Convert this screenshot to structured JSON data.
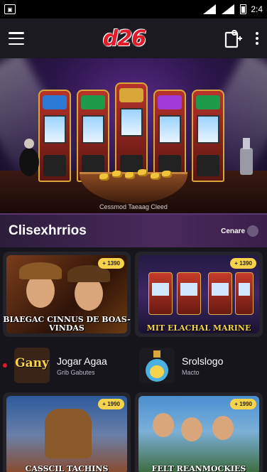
{
  "status_bar": {
    "time": "2:4"
  },
  "header": {
    "logo": "d26",
    "colors": {
      "logo": "#e21b2b",
      "accent": "#f6d34a"
    }
  },
  "banner": {
    "caption": "Cessmod Taeaag Cleed"
  },
  "section": {
    "title": "Clisexhrrios",
    "link_label": "Cenare"
  },
  "cards": [
    {
      "badge": "+ 1390",
      "caption": "BIAEGAC CINNUS DE BOAS-VINDAS"
    },
    {
      "badge": "+ 1390",
      "caption": "MIT ELACHAL MARINE"
    }
  ],
  "list": [
    {
      "title": "Jogar Agaa",
      "subtitle": "Grib Gabutes",
      "thumb_text": "Gany"
    },
    {
      "title": "Srolslogo",
      "subtitle": "Macto"
    }
  ],
  "cards2": [
    {
      "badge": "+ 1990",
      "caption": "CASSCIL TACHINS"
    },
    {
      "badge": "+ 1990",
      "caption": "FELT REANMOCKIES"
    }
  ]
}
